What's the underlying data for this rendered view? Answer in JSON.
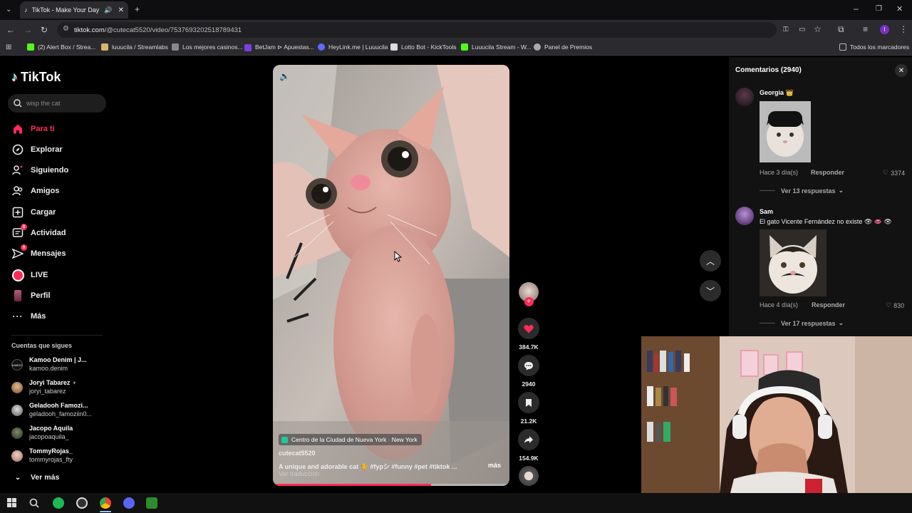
{
  "browser": {
    "tab_title": "TikTok - Make Your Day",
    "url_host": "tiktok.com",
    "url_path": "/@cutecat5520/video/7537693202518789431",
    "bookmarks": [
      {
        "label": "(2) Alert Box / Strea...",
        "color": "#53fc18"
      },
      {
        "label": "luuucila / Streamlabs",
        "color": "#d8b36a"
      },
      {
        "label": "Los mejores casinos...",
        "color": "#888888"
      },
      {
        "label": "BetJam ⊳ Apuestas...",
        "color": "#7b3fe4"
      },
      {
        "label": "HeyLink.me | Luuucila",
        "color": "#5b6cff"
      },
      {
        "label": "Lotto Bot - KickTools",
        "color": "#dddddd"
      },
      {
        "label": "Luuucila Stream - W...",
        "color": "#53fc18"
      },
      {
        "label": "Panel de Premios",
        "color": "#aaaaaa"
      }
    ],
    "all_bookmarks": "Todos los marcadores"
  },
  "sidebar": {
    "logo": "TikTok",
    "search_placeholder": "wisp the cat",
    "nav": [
      {
        "label": "Para ti",
        "icon": "home-icon",
        "active": true
      },
      {
        "label": "Explorar",
        "icon": "compass-icon"
      },
      {
        "label": "Siguiendo",
        "icon": "following-icon"
      },
      {
        "label": "Amigos",
        "icon": "friends-icon"
      },
      {
        "label": "Cargar",
        "icon": "upload-icon"
      },
      {
        "label": "Actividad",
        "icon": "activity-icon",
        "badge": "8"
      },
      {
        "label": "Mensajes",
        "icon": "messages-icon",
        "badge": "9"
      },
      {
        "label": "LIVE",
        "icon": "live-icon"
      },
      {
        "label": "Perfil",
        "icon": "profile-icon"
      },
      {
        "label": "Más",
        "icon": "more-icon"
      }
    ],
    "following_title": "Cuentas que sigues",
    "accounts": [
      {
        "name": "Kamoo Denim | J...",
        "handle": "kamoo.denim"
      },
      {
        "name": "Joryi Tabarez ♆",
        "handle": "joryi_tabarez"
      },
      {
        "name": "Geladooh Famozi...",
        "handle": "geladooh_famoziin0..."
      },
      {
        "name": "Jacopo Aquila",
        "handle": "jacopoaquila_"
      },
      {
        "name": "TommyRojas_",
        "handle": "tommyrojas_fty"
      }
    ],
    "see_more": "Ver más"
  },
  "video": {
    "location": "Centro de la Ciudad de Nueva York · New York",
    "author": "cutecat5520",
    "description": "A unique and adorable cat 🐈 #fypシ #funny #pet #tiktok ...",
    "more": "más",
    "translate": "Ver traducción",
    "progress": 0.67
  },
  "actions": {
    "likes": "384.7K",
    "comments": "2940",
    "saves": "21.2K",
    "shares": "154.9K"
  },
  "comments_panel": {
    "title": "Comentarios (2940)",
    "items": [
      {
        "user": "Georgia 👑",
        "text": "",
        "time": "Hace 3 día(s)",
        "reply": "Responder",
        "likes": "3374",
        "view_replies": "Ver 13 respuestas"
      },
      {
        "user": "Sam",
        "text": "El gato Vicente Fernández no existe 👁 👄 👁",
        "time": "Hace 4 día(s)",
        "reply": "Responder",
        "likes": "830",
        "view_replies": "Ver 17 respuestas"
      }
    ]
  },
  "colors": {
    "accent": "#fe2c55"
  }
}
